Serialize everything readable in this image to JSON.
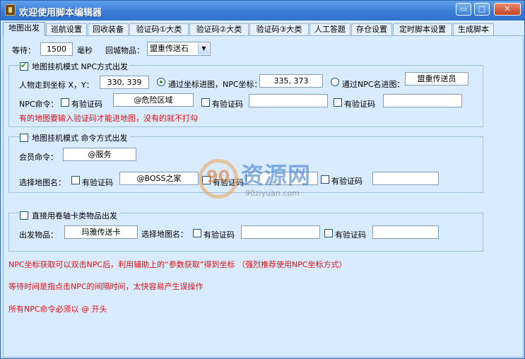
{
  "window": {
    "title": "欢迎使用脚本编辑器",
    "min": "▭",
    "max": "□",
    "close": "✕"
  },
  "tabs": [
    "地图出发",
    "巡航设置",
    "回收装备",
    "验证码①大类",
    "验证码②大类",
    "验证码③大类",
    "人工答题",
    "存仓设置",
    "定时脚本设置",
    "生成脚本"
  ],
  "top": {
    "wait_label": "等待：",
    "wait_value": "1500",
    "wait_unit": "毫秒",
    "return_label": "回城物品：",
    "return_value": "盟重传送石"
  },
  "g1": {
    "legend": "地图挂机模式  NPC方式出发",
    "walk_label": "人物走到坐标 X，Y：",
    "walk_value": "330, 339",
    "radio1_label": "通过坐标进图，NPC坐标：",
    "npc_coord": "335, 373",
    "radio2_label": "通过NPC名进图：",
    "npc_name": "盟重传送员",
    "cmd_label": "NPC命令：",
    "verify": "有验证码",
    "cmd_value": "@危险区域",
    "note": "有的地图要输入验证码才能进地图，没有的就不打勾"
  },
  "g2": {
    "legend": "地图挂机模式  命令方式出发",
    "member_label": "会员命令：",
    "member_value": "@服务",
    "map_label": "选择地图名：",
    "verify": "有验证码",
    "map_value": "@BOSS之家"
  },
  "g3": {
    "legend": "直接用卷轴卡类物品出发",
    "item_label": "出发物品：",
    "item_value": "玛雅传送卡",
    "map_label": "选择地图名：",
    "verify": "有验证码"
  },
  "notes": [
    "NPC坐标获取可以双击NPC后，利用辅助上的“参数获取”得到坐标 （强烈推荐使用NPC坐标方式）",
    "等待时间是指点击NPC的间隔时间，太快容易产生误操作",
    "所有NPC命令必须以 @ 开头"
  ],
  "watermark": {
    "logo": "90",
    "big": "资源网",
    "small": "90ziyuan.com"
  }
}
